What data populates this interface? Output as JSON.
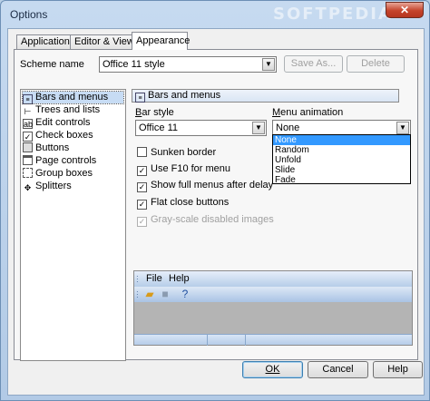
{
  "window": {
    "title": "Options",
    "watermark": "SOFTPEDIA",
    "close_glyph": "✕"
  },
  "tabs": [
    {
      "label": "Application"
    },
    {
      "label": "Editor & Viewers"
    },
    {
      "label": "Appearance",
      "active": true
    }
  ],
  "scheme": {
    "label": "Scheme name",
    "value": "Office 11 style",
    "save_as": "Save As...",
    "delete": "Delete"
  },
  "nav": {
    "items": [
      {
        "label": "Bars and menus",
        "icon": "bars-menus-icon",
        "selected": true
      },
      {
        "label": "Trees and lists",
        "icon": "tree-icon"
      },
      {
        "label": "Edit controls",
        "icon": "edit-icon"
      },
      {
        "label": "Check boxes",
        "icon": "checkbox-icon"
      },
      {
        "label": "Buttons",
        "icon": "button-icon"
      },
      {
        "label": "Page controls",
        "icon": "page-icon"
      },
      {
        "label": "Group boxes",
        "icon": "groupbox-icon"
      },
      {
        "label": "Splitters",
        "icon": "splitter-icon"
      }
    ]
  },
  "section": {
    "title": "Bars and menus"
  },
  "bar_style": {
    "label": "Bar style",
    "value": "Office 11"
  },
  "menu_animation": {
    "label": "Menu animation",
    "value": "None",
    "options": [
      "None",
      "Random",
      "Unfold",
      "Slide",
      "Fade"
    ],
    "highlighted": "None"
  },
  "checks": [
    {
      "label": "Sunken border",
      "checked": false,
      "enabled": true
    },
    {
      "label": "Use F10 for menu",
      "checked": true,
      "enabled": true
    },
    {
      "label": "Show full menus after delay",
      "checked": true,
      "enabled": true
    },
    {
      "label": "Flat close buttons",
      "checked": true,
      "enabled": true
    },
    {
      "label": "Gray-scale disabled images",
      "checked": true,
      "enabled": false
    }
  ],
  "preview": {
    "menu": [
      "File",
      "Help"
    ],
    "toolbar_icons": [
      "open-icon",
      "save-icon",
      "help-icon"
    ]
  },
  "footer": {
    "ok": "OK",
    "cancel": "Cancel",
    "help": "Help"
  },
  "colors": {
    "accent": "#3399ff",
    "titlebar": "#b9cfe6",
    "close": "#c5432b"
  }
}
